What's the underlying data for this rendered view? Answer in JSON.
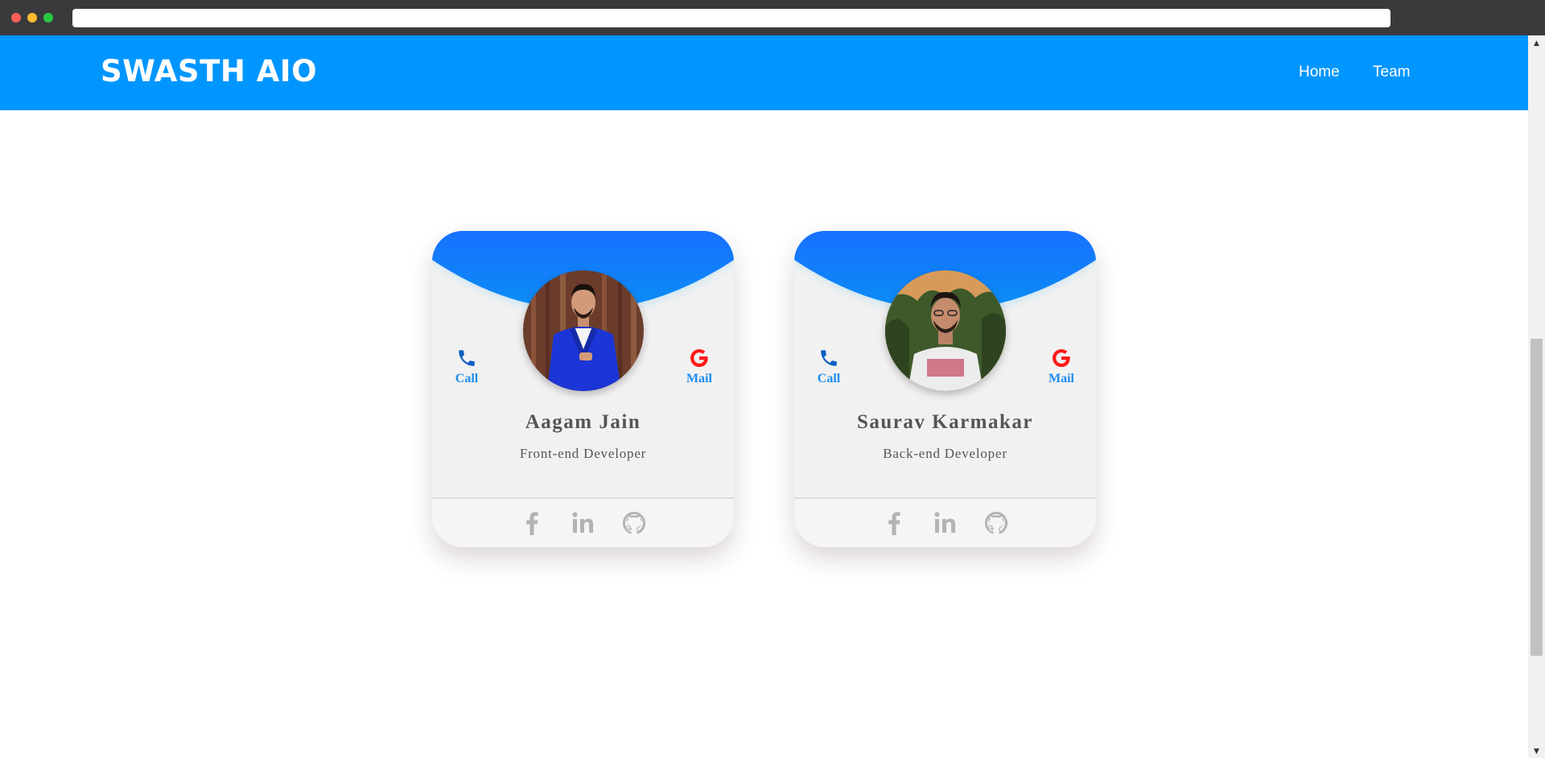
{
  "browser": {
    "url": ""
  },
  "navbar": {
    "brand": "SWASTH AIO",
    "links": [
      {
        "label": "Home"
      },
      {
        "label": "Team"
      }
    ]
  },
  "team": [
    {
      "name": "Aagam Jain",
      "role": "Front-end Developer",
      "call_label": "Call",
      "mail_label": "Mail",
      "avatar_icon": "portrait-photo",
      "social_icons": [
        "facebook-icon",
        "linkedin-icon",
        "github-icon"
      ]
    },
    {
      "name": "Saurav Karmakar",
      "role": "Back-end Developer",
      "call_label": "Call",
      "mail_label": "Mail",
      "avatar_icon": "portrait-photo",
      "social_icons": [
        "facebook-icon",
        "linkedin-icon",
        "github-icon"
      ]
    }
  ],
  "colors": {
    "navbar": "#0096ff",
    "card_header": "#1a7bff",
    "card_body": "#f2f1f1",
    "accent_text": "#1b8cf0",
    "call_icon": "#0d5ec2",
    "mail_icon": "#ff1a1a",
    "social_icon": "#b3b3b3",
    "name_text": "#555555"
  }
}
